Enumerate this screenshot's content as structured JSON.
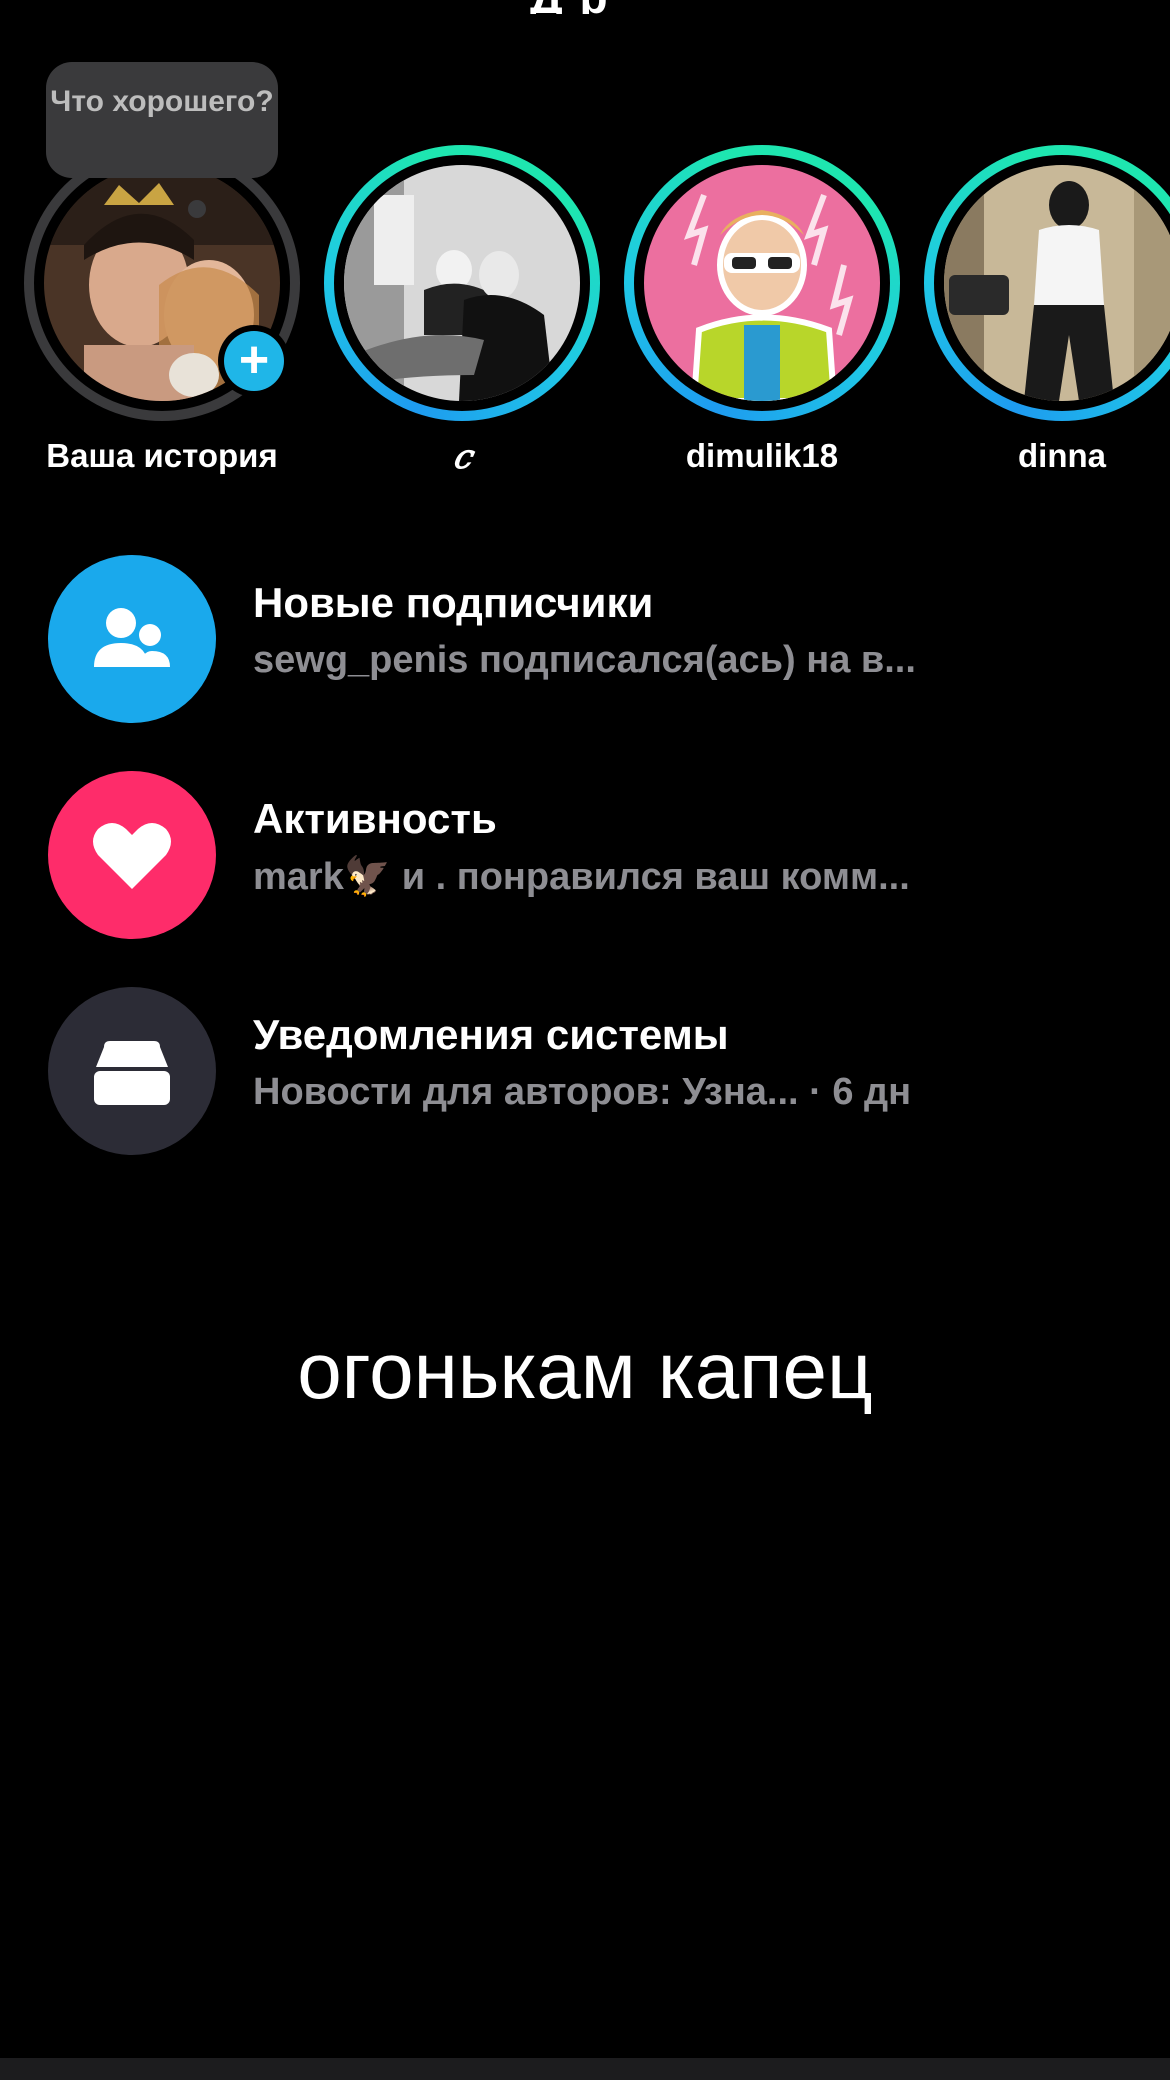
{
  "header": {
    "title_partial": "Д р"
  },
  "stories": {
    "tooltip": "Что хорошего?",
    "items": [
      {
        "label": "Ваша история",
        "own": true
      },
      {
        "label": "𝑐",
        "own": false
      },
      {
        "label": "dimulik18",
        "own": false
      },
      {
        "label": "dinna",
        "own": false
      }
    ],
    "add_icon": "plus-icon"
  },
  "notifications": [
    {
      "title": "Новые подписчики",
      "subtitle": "sewg_penis подписался(ась) на в...",
      "icon": "followers-icon",
      "color": "#1aa9ec"
    },
    {
      "title": "Активность",
      "subtitle": "mark🦅 и . понравился ваш комм...",
      "icon": "heart-icon",
      "color": "#fe2c6a"
    },
    {
      "title": "Уведомления системы",
      "subtitle": "Новости для авторов: Узна...",
      "time": " · 6 дн",
      "icon": "inbox-icon",
      "color": "#2c2c36"
    }
  ],
  "caption": "огонькам капец",
  "colors": {
    "background": "#000000",
    "ring_start": "#1e9bf0",
    "ring_end": "#1ee6b0",
    "muted_text": "#8e8e93"
  }
}
